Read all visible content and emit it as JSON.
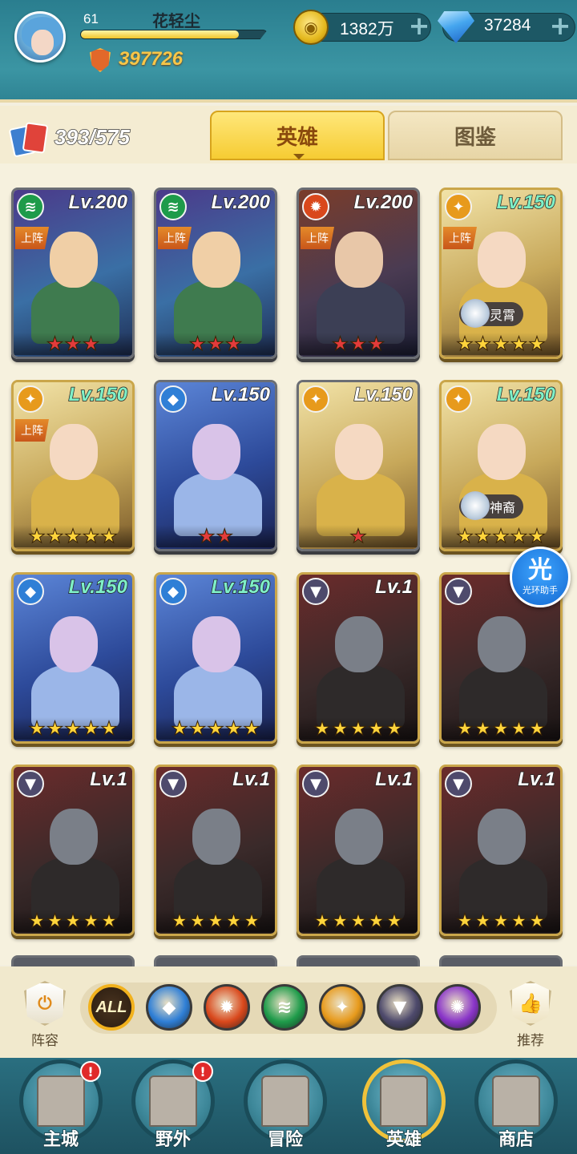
{
  "player": {
    "level": "61",
    "name": "花轻尘",
    "xp_fraction": 0.85,
    "power": "397726"
  },
  "resources": {
    "gold": "1382万",
    "gems": "37284",
    "plus_symbol": "+"
  },
  "collection": {
    "count": "393/575"
  },
  "tabs": [
    {
      "label": "英雄",
      "active": true
    },
    {
      "label": "图鉴",
      "active": false
    }
  ],
  "heroes": [
    {
      "level": "Lv.200",
      "faction": "nature",
      "deployed": true,
      "stars": 3,
      "star_color": "red",
      "title": ""
    },
    {
      "level": "Lv.200",
      "faction": "nature",
      "deployed": true,
      "stars": 3,
      "star_color": "red",
      "title": ""
    },
    {
      "level": "Lv.200",
      "faction": "fire",
      "deployed": true,
      "stars": 3,
      "star_color": "red",
      "title": ""
    },
    {
      "level": "Lv.150",
      "faction": "light",
      "deployed": true,
      "stars": 5,
      "star_color": "gold",
      "title": "灵霄"
    },
    {
      "level": "Lv.150",
      "faction": "light",
      "deployed": true,
      "stars": 5,
      "star_color": "gold",
      "title": ""
    },
    {
      "level": "Lv.150",
      "faction": "water",
      "deployed": false,
      "stars": 2,
      "star_color": "red",
      "title": ""
    },
    {
      "level": "Lv.150",
      "faction": "light",
      "deployed": false,
      "stars": 1,
      "star_color": "red",
      "title": ""
    },
    {
      "level": "Lv.150",
      "faction": "light",
      "deployed": false,
      "stars": 5,
      "star_color": "gold",
      "title": "神裔"
    },
    {
      "level": "Lv.150",
      "faction": "water",
      "deployed": false,
      "stars": 5,
      "star_color": "gold",
      "title": ""
    },
    {
      "level": "Lv.150",
      "faction": "water",
      "deployed": false,
      "stars": 5,
      "star_color": "gold",
      "title": ""
    },
    {
      "level": "Lv.1",
      "faction": "dark",
      "deployed": false,
      "stars": 5,
      "star_color": "gold",
      "title": ""
    },
    {
      "level": "Lv.1",
      "faction": "dark",
      "deployed": false,
      "stars": 5,
      "star_color": "gold",
      "title": ""
    },
    {
      "level": "Lv.1",
      "faction": "dark",
      "deployed": false,
      "stars": 5,
      "star_color": "gold",
      "title": ""
    },
    {
      "level": "Lv.1",
      "faction": "dark",
      "deployed": false,
      "stars": 5,
      "star_color": "gold",
      "title": ""
    },
    {
      "level": "Lv.1",
      "faction": "dark",
      "deployed": false,
      "stars": 5,
      "star_color": "gold",
      "title": ""
    },
    {
      "level": "Lv.1",
      "faction": "dark",
      "deployed": false,
      "stars": 5,
      "star_color": "gold",
      "title": ""
    }
  ],
  "deploy_label": "上阵",
  "helper": {
    "glyph": "光",
    "label": "光环助手"
  },
  "filters": {
    "lineup_label": "阵容",
    "recommend_label": "推荐",
    "all_label": "ALL",
    "factions": [
      "water",
      "fire",
      "nature",
      "light",
      "dark",
      "arcane"
    ]
  },
  "faction_colors": {
    "water": "#2f7fd6",
    "fire": "#d9481c",
    "nature": "#1e9b4a",
    "light": "#e79a1c",
    "dark": "#4e4a6c",
    "arcane": "#8a35c9"
  },
  "faction_glyphs": {
    "water": "◆",
    "fire": "✹",
    "nature": "≋",
    "light": "✦",
    "dark": "▼",
    "arcane": "✺"
  },
  "nav": [
    {
      "label": "主城",
      "alert": "!",
      "icon": "castle-icon",
      "active": false
    },
    {
      "label": "野外",
      "alert": "!",
      "icon": "wilderness-icon",
      "active": false
    },
    {
      "label": "冒险",
      "alert": "",
      "icon": "adventure-icon",
      "active": false
    },
    {
      "label": "英雄",
      "alert": "",
      "icon": "hero-helmet-icon",
      "active": true
    },
    {
      "label": "商店",
      "alert": "",
      "icon": "shop-icon",
      "active": false
    }
  ]
}
